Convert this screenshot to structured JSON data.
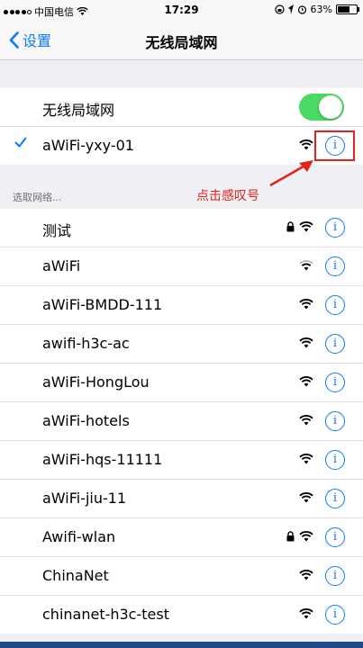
{
  "status_bar": {
    "carrier": "中国电信",
    "time": "17:29",
    "battery": "63%",
    "battery_level": 0.63
  },
  "nav": {
    "back_label": "设置",
    "title": "无线局域网"
  },
  "wlan_toggle": {
    "label": "无线局域网",
    "on": true
  },
  "connected": {
    "name": "aWiFi-yxy-01"
  },
  "section_header": "选取网络...",
  "annotation": "点击感叹号",
  "networks": [
    {
      "name": "测试",
      "locked": true,
      "signal": "strong"
    },
    {
      "name": "aWiFi",
      "locked": false,
      "signal": "weak"
    },
    {
      "name": "aWiFi-BMDD-111",
      "locked": false,
      "signal": "strong"
    },
    {
      "name": "awifi-h3c-ac",
      "locked": false,
      "signal": "strong"
    },
    {
      "name": "aWiFi-HongLou",
      "locked": false,
      "signal": "strong"
    },
    {
      "name": "aWiFi-hotels",
      "locked": false,
      "signal": "strong"
    },
    {
      "name": "aWiFi-hqs-11111",
      "locked": false,
      "signal": "strong"
    },
    {
      "name": "aWiFi-jiu-11",
      "locked": false,
      "signal": "strong"
    },
    {
      "name": "Awifi-wlan",
      "locked": true,
      "signal": "strong"
    },
    {
      "name": "ChinaNet",
      "locked": false,
      "signal": "strong"
    },
    {
      "name": "chinanet-h3c-test",
      "locked": false,
      "signal": "strong"
    }
  ],
  "colors": {
    "accent": "#0a7aff",
    "toggle_on": "#4cd964",
    "annotation": "#e0231c"
  }
}
